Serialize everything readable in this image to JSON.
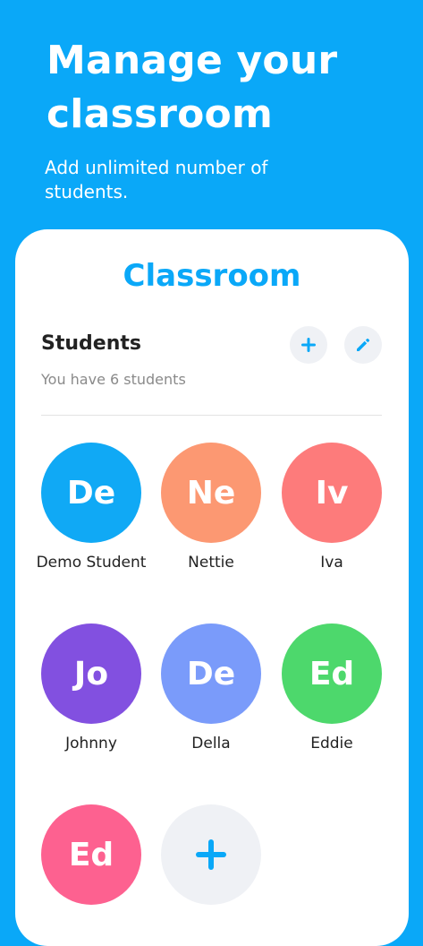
{
  "headline": "Manage your classroom",
  "subline": "Add unlimited number of students.",
  "card": {
    "title": "Classroom",
    "section_title": "Students",
    "section_count": "You have 6 students"
  },
  "colors": {
    "background": "#0aa8f8",
    "accent": "#0aa8f8",
    "button_bg": "#eff1f5"
  },
  "icons": {
    "add": "plus-icon",
    "edit": "pencil-icon"
  },
  "students": [
    {
      "initials": "De",
      "name": "Demo Student",
      "color": "#10a9f5"
    },
    {
      "initials": "Ne",
      "name": "Nettie",
      "color": "#fc9872"
    },
    {
      "initials": "Iv",
      "name": "Iva",
      "color": "#fd7b7b"
    },
    {
      "initials": "Jo",
      "name": "Johnny",
      "color": "#8250e0"
    },
    {
      "initials": "De",
      "name": "Della",
      "color": "#7a9bfa"
    },
    {
      "initials": "Ed",
      "name": "Eddie",
      "color": "#4dd86c"
    },
    {
      "initials": "Ed",
      "name": "",
      "color": "#fd6190"
    }
  ]
}
